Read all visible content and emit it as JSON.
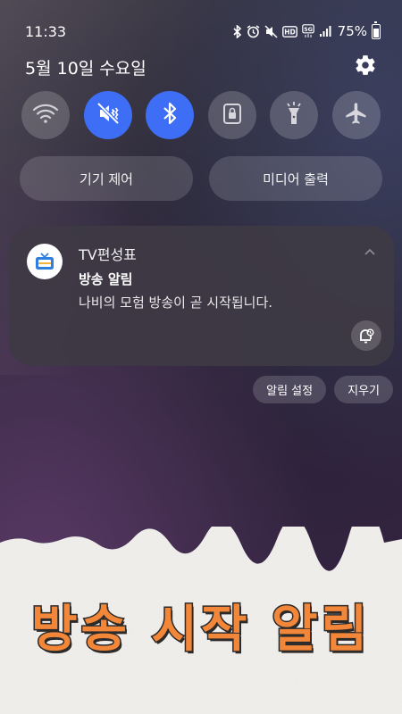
{
  "status_bar": {
    "time": "11:33",
    "icons": [
      "bluetooth-icon",
      "alarm-icon",
      "mute-icon",
      "hd-icon",
      "5g-icon",
      "signal-icon"
    ],
    "battery": "75%",
    "battery_level": 0.75
  },
  "header": {
    "date": "5월 10일 수요일",
    "settings_icon": "gear-icon"
  },
  "quick_settings": [
    {
      "name": "wifi",
      "icon": "wifi-icon",
      "on": false
    },
    {
      "name": "sound",
      "icon": "mute-icon",
      "on": true
    },
    {
      "name": "bluetooth",
      "icon": "bluetooth-icon",
      "on": true
    },
    {
      "name": "rotation-lock",
      "icon": "lock-icon",
      "on": false
    },
    {
      "name": "flashlight",
      "icon": "flashlight-icon",
      "on": false
    },
    {
      "name": "airplane",
      "icon": "airplane-icon",
      "on": false
    }
  ],
  "panels": {
    "device_control": "기기 제어",
    "media_output": "미디어 출력"
  },
  "notification": {
    "app_name": "TV편성표",
    "title": "방송 알림",
    "body": "나비의 모험 방송이 곧 시작됩니다."
  },
  "actions": {
    "settings": "알림 설정",
    "clear": "지우기"
  },
  "banner": {
    "text": "방송 시작 알림"
  },
  "colors": {
    "accent": "#3d6ef5",
    "banner_text": "#f2873a"
  }
}
